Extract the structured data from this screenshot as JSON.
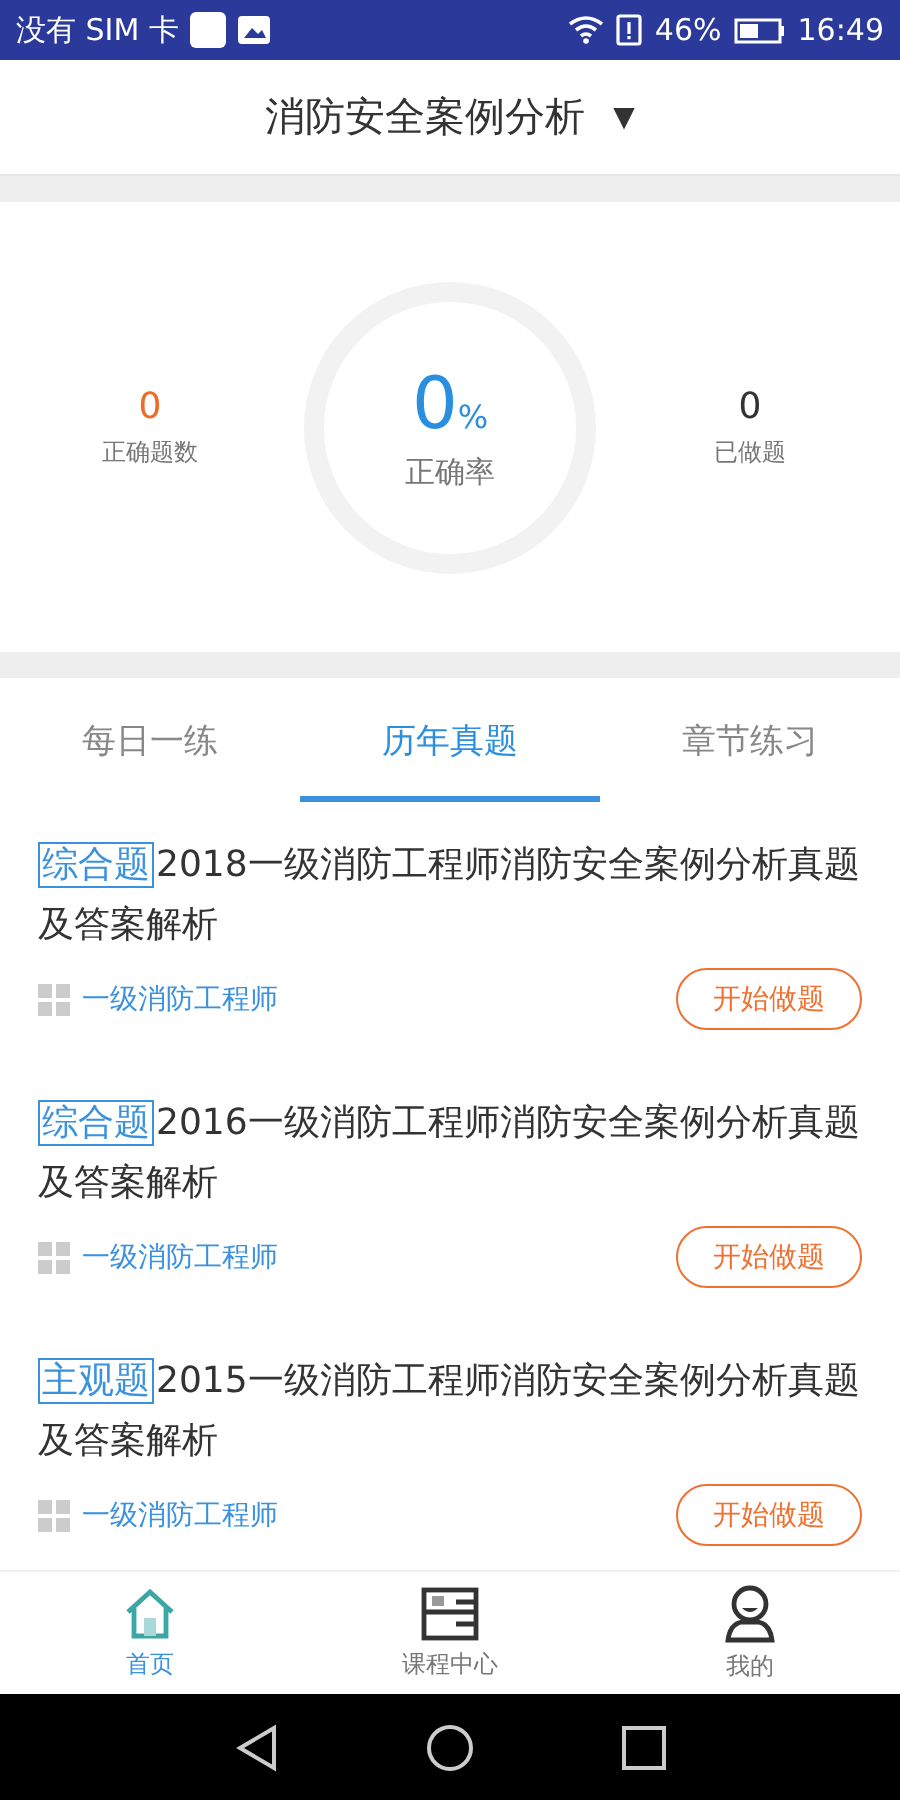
{
  "status_bar": {
    "carrier": "没有 SIM 卡",
    "battery_percent": "46%",
    "time": "16:49"
  },
  "header": {
    "title": "消防安全案例分析",
    "dropdown": "▼"
  },
  "stats": [
    {
      "kind": "count",
      "value": "0",
      "label": "正确题数"
    },
    {
      "kind": "rate",
      "value": "0",
      "unit": "%",
      "label": "正确率"
    },
    {
      "kind": "plain",
      "value": "0",
      "label": "已做题"
    }
  ],
  "tabs": [
    {
      "label": "每日一练",
      "selected": false
    },
    {
      "label": "历年真题",
      "selected": true
    },
    {
      "label": "章节练习",
      "selected": false
    }
  ],
  "items": [
    {
      "tag": "综合题",
      "title": "2018一级消防工程师消防安全案例分析真题及答案解析",
      "category": "一级消防工程师",
      "action": "开始做题"
    },
    {
      "tag": "综合题",
      "title": "2016一级消防工程师消防安全案例分析真题及答案解析",
      "category": "一级消防工程师",
      "action": "开始做题"
    },
    {
      "tag": "主观题",
      "title": "2015一级消防工程师消防安全案例分析真题及答案解析",
      "category": "一级消防工程师",
      "action": "开始做题"
    }
  ],
  "bottom_nav": [
    {
      "label": "首页",
      "kind": "home",
      "selected": true
    },
    {
      "label": "课程中心",
      "kind": "book",
      "selected": false
    },
    {
      "label": "我的",
      "kind": "person",
      "selected": false
    }
  ]
}
